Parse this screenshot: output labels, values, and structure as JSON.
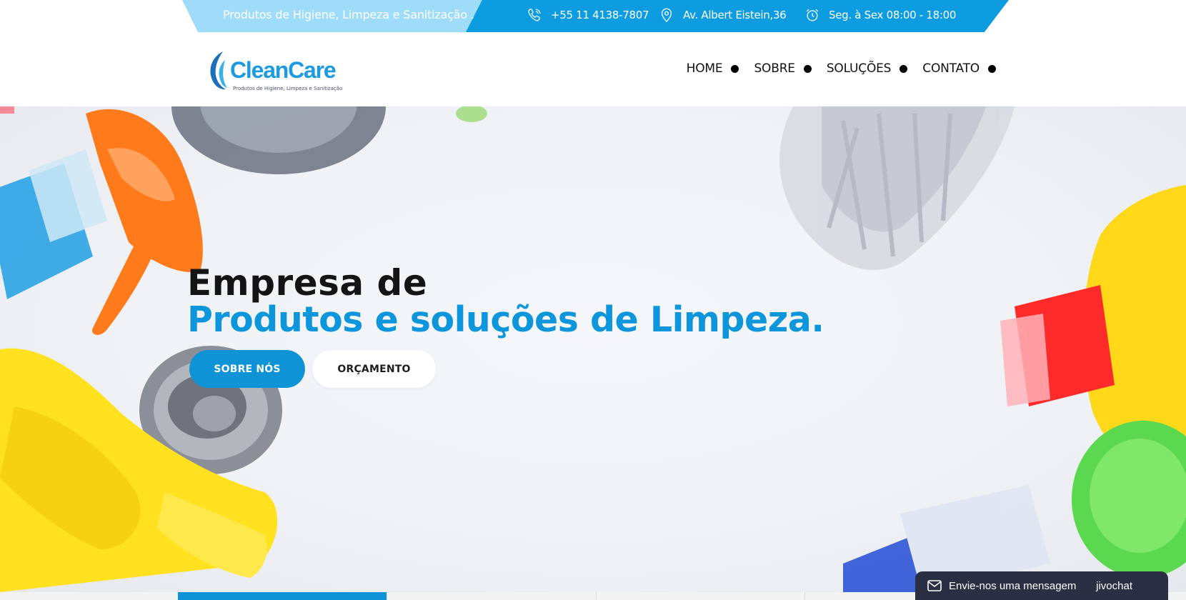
{
  "topbar": {
    "tagline": "Produtos de Higiene, Limpeza e Sanitização .",
    "phone": "+55 11 4138-7807",
    "address": "Av. Albert Eistein,36",
    "hours": "Seg. à Sex 08:00 - 18:00",
    "icons": {
      "phone": "phone-icon",
      "address": "location-pin-icon",
      "hours": "alarm-clock-icon"
    },
    "colors": {
      "light": "#9fdcfa",
      "dark": "#0d9ce0"
    }
  },
  "logo": {
    "brand": "CleanCare",
    "tagline": "Produtos de Higiene, Limpeza e Sanitização"
  },
  "nav": {
    "items": [
      {
        "label": "HOME"
      },
      {
        "label": "SOBRE"
      },
      {
        "label": "SOLUÇÕES"
      },
      {
        "label": "CONTATO"
      }
    ]
  },
  "hero": {
    "title_line1": "Empresa de",
    "title_line2": "Produtos e soluções de Limpeza.",
    "primary_button": "SOBRE NÓS",
    "secondary_button": "ORÇAMENTO",
    "accent_color": "#0d96db"
  },
  "chat": {
    "label": "Envie-nos uma mensagem",
    "brand": "jivochat",
    "icon": "envelope-icon"
  },
  "slider_tabs": {
    "count": 6,
    "active_index": 0
  }
}
